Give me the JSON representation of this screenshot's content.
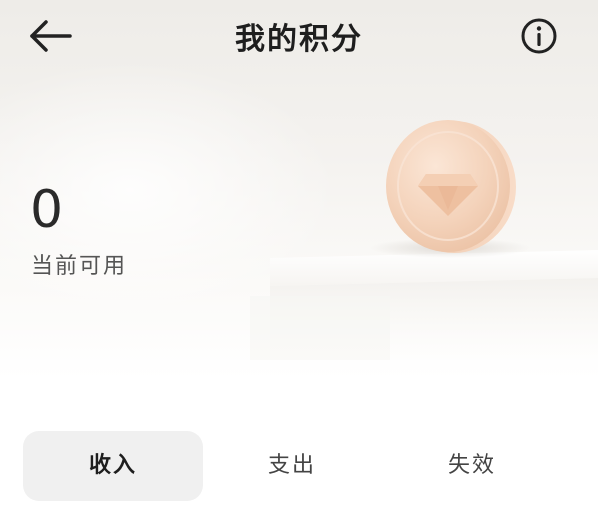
{
  "header": {
    "title": "我的积分",
    "back_icon": "arrow-left-icon",
    "info_icon": "info-circle-icon"
  },
  "points": {
    "value": "0",
    "label": "当前可用"
  },
  "tabs": [
    {
      "label": "收入",
      "active": true
    },
    {
      "label": "支出",
      "active": false
    },
    {
      "label": "失效",
      "active": false
    }
  ],
  "colors": {
    "coin": "#f3d2b8",
    "tab_active_bg": "#f0f0f0",
    "hero_bg": "#efede9"
  }
}
